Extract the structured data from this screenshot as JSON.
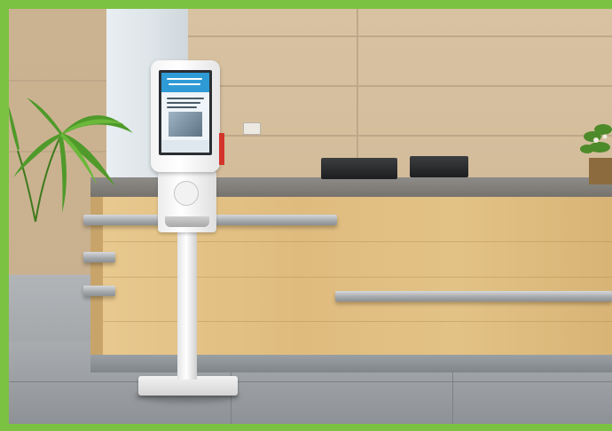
{
  "scene": {
    "subject": "kiosk",
    "frame_color": "#7cc242",
    "kiosk": {
      "screen_banner_color": "#2f9bd6",
      "accent_color": "#d2332a"
    }
  }
}
